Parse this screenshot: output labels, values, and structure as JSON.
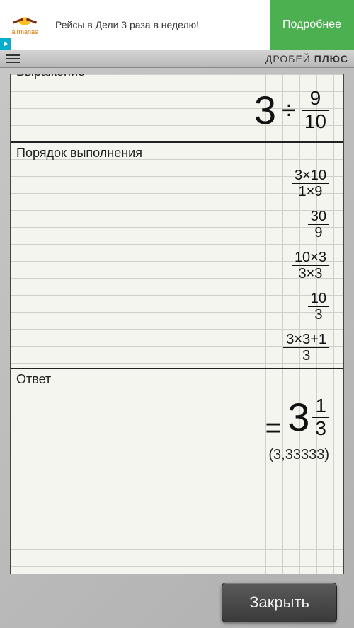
{
  "ad": {
    "brand": "airmanas",
    "text": "Рейсы в Дели 3 раза в неделю!",
    "cta": "Подробнее"
  },
  "app": {
    "title_a": "ДРОБЕЙ ",
    "title_b": "ПЛЮС"
  },
  "labels": {
    "expression": "Выражение",
    "steps": "Порядок выполнения",
    "answer": "Ответ"
  },
  "expression": {
    "whole": "3",
    "op": "÷",
    "frac_num": "9",
    "frac_den": "10"
  },
  "steps": [
    {
      "num": "3×10",
      "den": "1×9"
    },
    {
      "num": "30",
      "den": "9"
    },
    {
      "num": "10×3",
      "den": "3×3"
    },
    {
      "num": "10",
      "den": "3"
    },
    {
      "num": "3×3+1",
      "den": "3"
    }
  ],
  "answer": {
    "eq": "=",
    "whole": "3",
    "frac_num": "1",
    "frac_den": "3",
    "decimal": "(3,33333)"
  },
  "buttons": {
    "close": "Закрыть"
  }
}
